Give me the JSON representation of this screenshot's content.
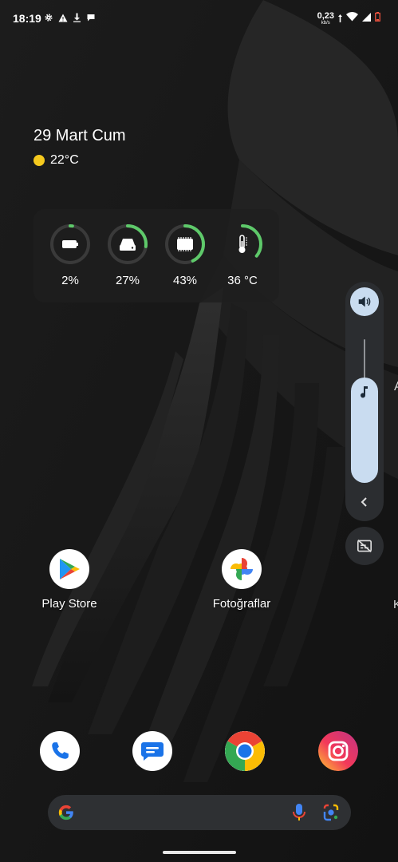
{
  "status_bar": {
    "time": "18:19",
    "net_speed_value": "0,23",
    "net_speed_unit": "kb/s",
    "left_icons": [
      "gear-icon",
      "warning-icon",
      "download-icon",
      "chat-bubble-icon"
    ],
    "right_icons": [
      "wifi-icon",
      "signal-icon",
      "battery-icon"
    ]
  },
  "widget": {
    "date": "29 Mart Cum",
    "weather_temp": "22°C"
  },
  "stats": [
    {
      "icon": "battery-icon",
      "label": "2%",
      "level": 0.02
    },
    {
      "icon": "storage-icon",
      "label": "27%",
      "level": 0.27
    },
    {
      "icon": "memory-chip-icon",
      "label": "43%",
      "level": 0.43
    },
    {
      "icon": "thermometer-icon",
      "label": "36 °C",
      "level": 0.36
    }
  ],
  "volume": {
    "level": 0.62,
    "icons": [
      "speaker-icon",
      "music-note-icon",
      "chevron-left-icon",
      "caption-off-icon"
    ]
  },
  "apps": [
    {
      "name": "Play Store",
      "icon": "play-store-icon"
    },
    {
      "name": "Fotoğraflar",
      "icon": "photos-icon"
    }
  ],
  "dock": [
    "phone-icon",
    "messages-icon",
    "chrome-icon",
    "instagram-icon"
  ],
  "search": {
    "icons": [
      "google-g-icon",
      "mic-icon",
      "lens-icon"
    ]
  },
  "colors": {
    "ring_accent": "#5ec96a",
    "ring_track": "#3a3a3a",
    "volume_accent": "#c9dcf0",
    "panel_bg": "#2b2d30"
  },
  "edge_fragments": {
    "right_a": "A",
    "right_k": "K"
  }
}
